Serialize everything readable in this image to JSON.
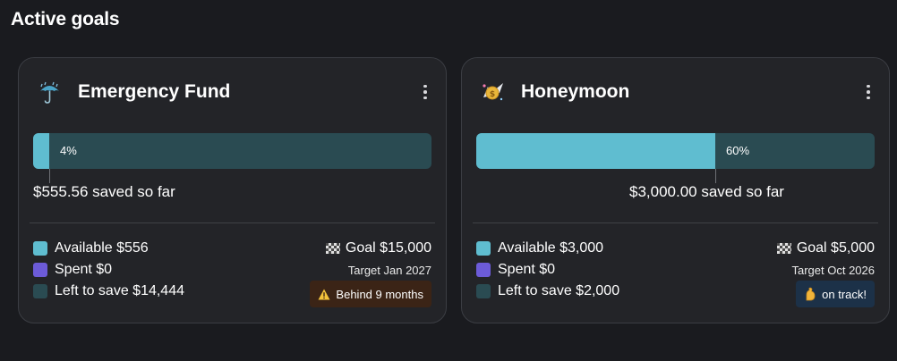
{
  "page": {
    "title": "Active goals"
  },
  "colors": {
    "available": "#5fbdd0",
    "spent": "#6c5bd8",
    "left_to_save": "#2a4b52",
    "behind_badge_bg": "#3b2416",
    "on_track_badge_bg": "#1c3148"
  },
  "goals": [
    {
      "icon": "umbrella-icon",
      "name": "Emergency Fund",
      "progress_percent": 4,
      "progress_label": "4%",
      "saved_text": "$555.56 saved so far",
      "legend": {
        "available": "Available $556",
        "spent": "Spent  $0",
        "left": "Left to save  $14,444"
      },
      "goal_text": "Goal $15,000",
      "target_text": "Target Jan 2027",
      "status": {
        "icon": "warning-icon",
        "text": "Behind 9 months"
      }
    },
    {
      "icon": "flying-money-icon",
      "name": "Honeymoon",
      "progress_percent": 60,
      "progress_label": "60%",
      "saved_text": "$3,000.00 saved so far",
      "legend": {
        "available": "Available $3,000",
        "spent": "Spent  $0",
        "left": "Left to save  $2,000"
      },
      "goal_text": "Goal $5,000",
      "target_text": "Target Oct 2026",
      "status": {
        "icon": "flexed-biceps-icon",
        "text": "on track!"
      }
    }
  ]
}
